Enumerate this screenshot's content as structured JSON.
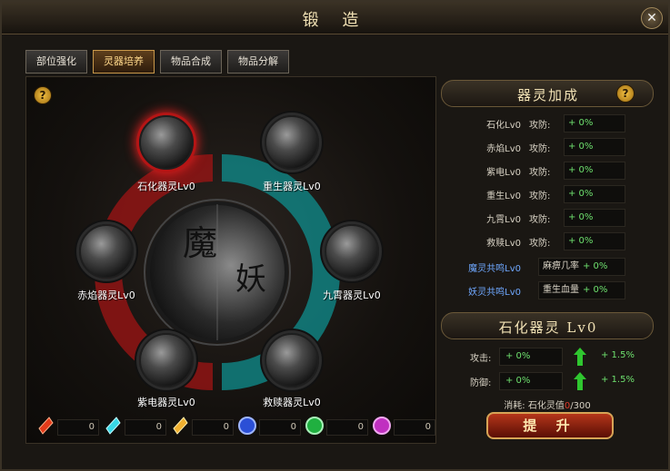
{
  "window": {
    "title": "锻 造"
  },
  "tabs": [
    {
      "label": "部位强化"
    },
    {
      "label": "灵器培养"
    },
    {
      "label": "物品合成"
    },
    {
      "label": "物品分解"
    }
  ],
  "center_glyphs": {
    "left": "魔",
    "right": "妖"
  },
  "spirits": [
    {
      "label": "石化器灵Lv0"
    },
    {
      "label": "重生器灵Lv0"
    },
    {
      "label": "赤焰器灵Lv0"
    },
    {
      "label": "九霄器灵Lv0"
    },
    {
      "label": "紫电器灵Lv0"
    },
    {
      "label": "救赎器灵Lv0"
    }
  ],
  "gems": [
    {
      "count": "0",
      "color": "#e23a1a"
    },
    {
      "count": "0",
      "color": "#38d8e6"
    },
    {
      "count": "0",
      "color": "#f0b030"
    },
    {
      "count": "0",
      "color": "#2b4fd6"
    },
    {
      "count": "0",
      "color": "#20b040"
    },
    {
      "count": "0",
      "color": "#c030c0"
    }
  ],
  "bonus_panel": {
    "title": "器灵加成",
    "rows": [
      {
        "name": "石化Lv0",
        "kind": "攻防:",
        "value": "+ 0%"
      },
      {
        "name": "赤焰Lv0",
        "kind": "攻防:",
        "value": "+ 0%"
      },
      {
        "name": "紫电Lv0",
        "kind": "攻防:",
        "value": "+ 0%"
      },
      {
        "name": "重生Lv0",
        "kind": "攻防:",
        "value": "+ 0%"
      },
      {
        "name": "九霄Lv0",
        "kind": "攻防:",
        "value": "+ 0%"
      },
      {
        "name": "救赎Lv0",
        "kind": "攻防:",
        "value": "+ 0%"
      }
    ],
    "resonance": [
      {
        "name": "魔灵共鸣Lv0",
        "effect": "麻痹几率",
        "value": "+ 0%"
      },
      {
        "name": "妖灵共鸣Lv0",
        "effect": "重生血量",
        "value": "+ 0%"
      }
    ]
  },
  "selected": {
    "title": "石化器灵 Lv0",
    "attack_label": "攻击:",
    "attack_value": "+ 0%",
    "attack_increase": "+ 1.5%",
    "defense_label": "防御:",
    "defense_value": "+ 0%",
    "defense_increase": "+ 1.5%",
    "cost_prefix": "消耗: 石化灵值",
    "cost_current": "0",
    "cost_max": "/300",
    "upgrade_label": "提 升"
  },
  "colors": {
    "accent_gold": "#f2e2b5",
    "positive_green": "#6ee06e",
    "active_red": "#e02020",
    "resonance_blue": "#6fa8ff"
  }
}
